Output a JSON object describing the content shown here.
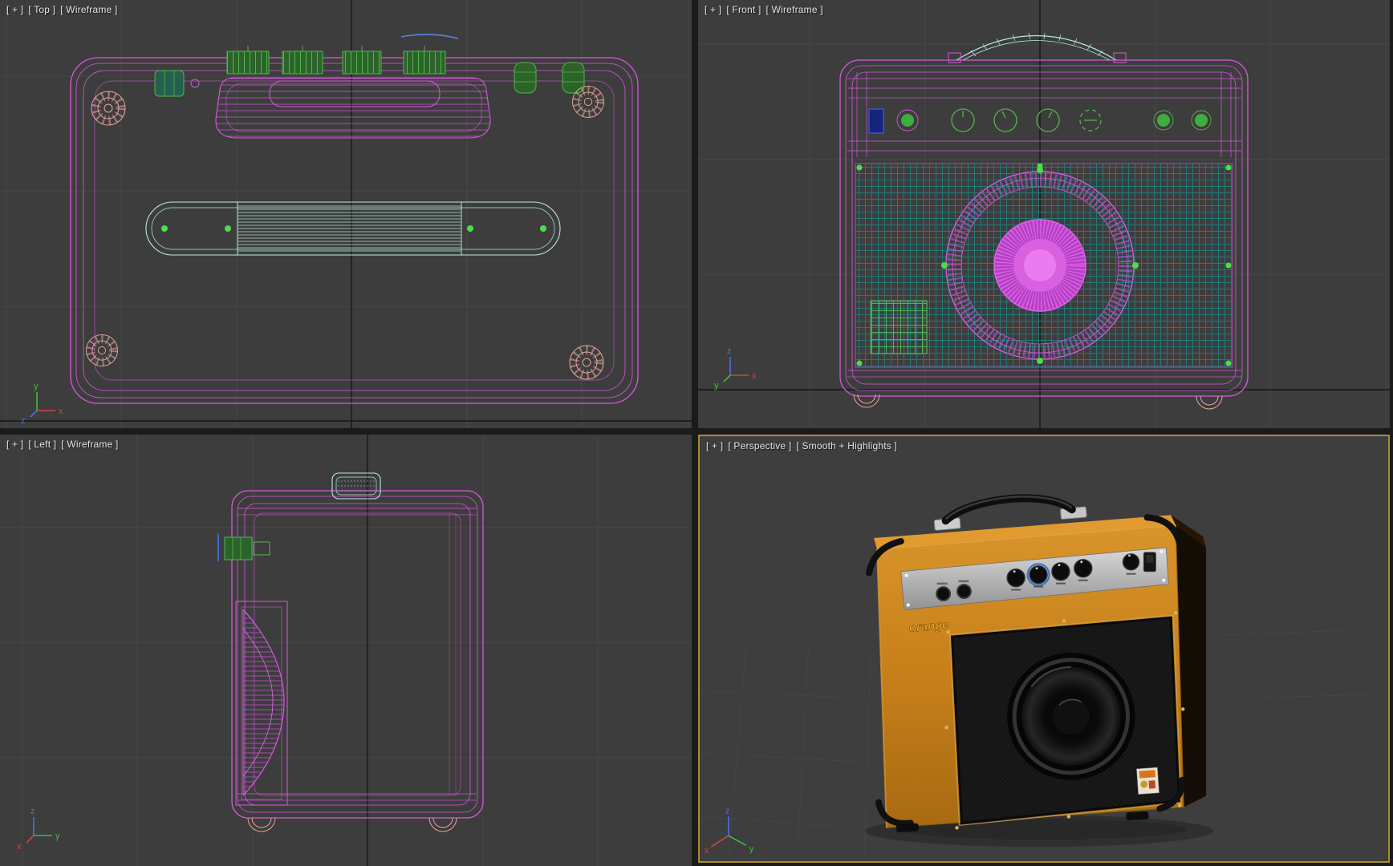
{
  "viewports": {
    "top": {
      "menu_button": "[ + ]",
      "view_label": "[ Top ]",
      "shading_label": "[ Wireframe ]"
    },
    "front": {
      "menu_button": "[ + ]",
      "view_label": "[ Front ]",
      "shading_label": "[ Wireframe ]"
    },
    "left": {
      "menu_button": "[ + ]",
      "view_label": "[ Left ]",
      "shading_label": "[ Wireframe ]"
    },
    "perspective": {
      "menu_button": "[ + ]",
      "view_label": "[ Perspective ]",
      "shading_label": "[ Smooth + Highlights ]",
      "active": true
    }
  },
  "axis_tripods": {
    "top": {
      "up": "y",
      "right": "x",
      "third": "z"
    },
    "front": {
      "up": "z",
      "right": "x",
      "third": "y"
    },
    "left": {
      "up": "z",
      "right": "y",
      "third": "x"
    },
    "perspective": {
      "up": "z",
      "right": "y",
      "third": "x"
    }
  },
  "scene": {
    "object": "guitar combo amplifier",
    "logo_text": "orange"
  },
  "colors": {
    "viewport_background": "#3d3d3d",
    "grid_line": "#484848",
    "world_axis_line": "#161616",
    "active_viewport_border": "#ab8b2f",
    "wireframe_magenta": "#d957e0",
    "wireframe_cyan": "#b5ece2",
    "wireframe_green": "#54b54a",
    "wireframe_salmon": "#eaa79e",
    "grille_teal": "#1f7a78",
    "amp_orange": "#c9811b",
    "label_text": "#e4e4e4"
  }
}
